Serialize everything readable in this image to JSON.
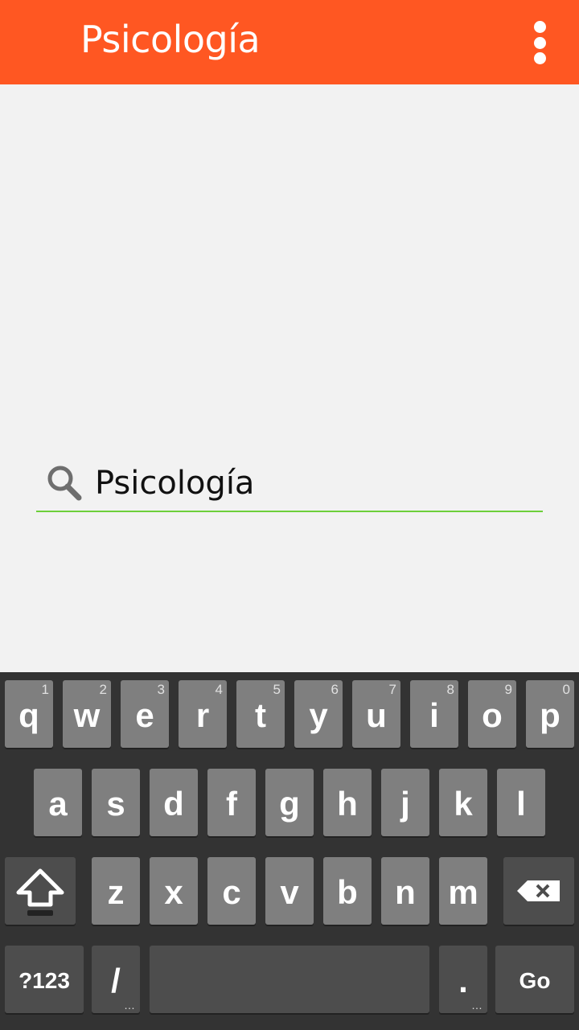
{
  "app_bar": {
    "title": "Psicología",
    "background": "#ff5722",
    "overflow_icon": "more-vert-icon"
  },
  "search": {
    "icon": "search-icon",
    "value": "Psicología",
    "underline_color": "#6dcf3a"
  },
  "keyboard": {
    "row1": [
      {
        "label": "q",
        "hint": "1"
      },
      {
        "label": "w",
        "hint": "2"
      },
      {
        "label": "e",
        "hint": "3"
      },
      {
        "label": "r",
        "hint": "4"
      },
      {
        "label": "t",
        "hint": "5"
      },
      {
        "label": "y",
        "hint": "6"
      },
      {
        "label": "u",
        "hint": "7"
      },
      {
        "label": "i",
        "hint": "8"
      },
      {
        "label": "o",
        "hint": "9"
      },
      {
        "label": "p",
        "hint": "0"
      }
    ],
    "row2": [
      "a",
      "s",
      "d",
      "f",
      "g",
      "h",
      "j",
      "k",
      "l"
    ],
    "row3": [
      "z",
      "x",
      "c",
      "v",
      "b",
      "n",
      "m"
    ],
    "shift_icon": "shift-icon",
    "backspace_icon": "backspace-icon",
    "symbols_label": "?123",
    "slash_label": "/",
    "slash_more": "…",
    "period_label": ".",
    "period_more": "…",
    "go_label": "Go"
  }
}
